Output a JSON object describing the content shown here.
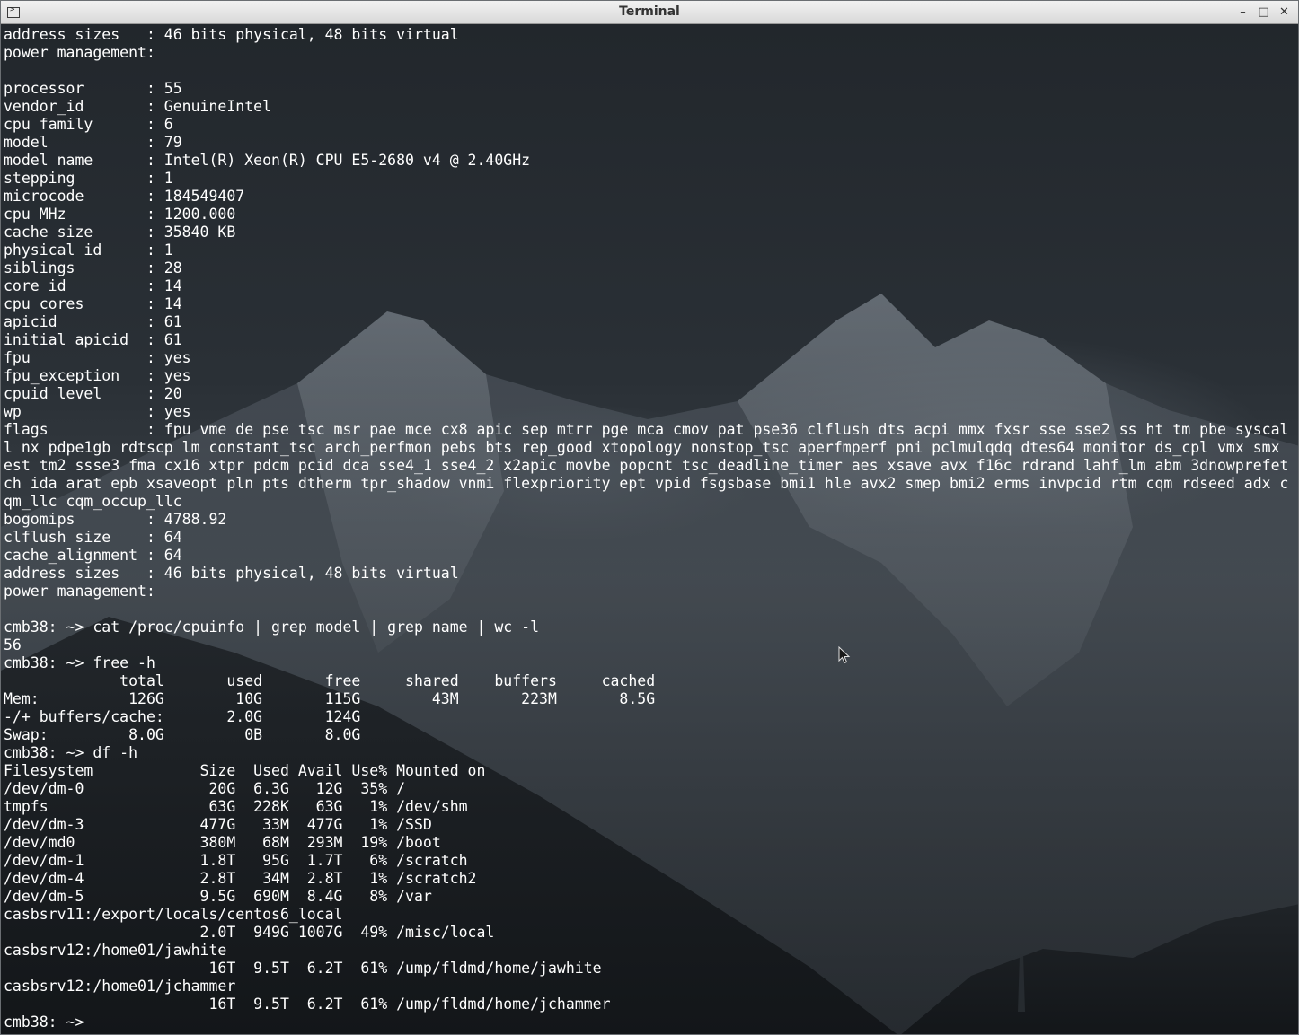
{
  "window": {
    "title": "Terminal",
    "minimize_glyph": "–",
    "maximize_glyph": "□",
    "close_glyph": "✕",
    "app_icon_glyph": ">_"
  },
  "terminal": {
    "lines": [
      "address sizes   : 46 bits physical, 48 bits virtual",
      "power management:",
      "",
      "processor       : 55",
      "vendor_id       : GenuineIntel",
      "cpu family      : 6",
      "model           : 79",
      "model name      : Intel(R) Xeon(R) CPU E5-2680 v4 @ 2.40GHz",
      "stepping        : 1",
      "microcode       : 184549407",
      "cpu MHz         : 1200.000",
      "cache size      : 35840 KB",
      "physical id     : 1",
      "siblings        : 28",
      "core id         : 14",
      "cpu cores       : 14",
      "apicid          : 61",
      "initial apicid  : 61",
      "fpu             : yes",
      "fpu_exception   : yes",
      "cpuid level     : 20",
      "wp              : yes",
      "flags           : fpu vme de pse tsc msr pae mce cx8 apic sep mtrr pge mca cmov pat pse36 clflush dts acpi mmx fxsr sse sse2 ss ht tm pbe syscal",
      "l nx pdpe1gb rdtscp lm constant_tsc arch_perfmon pebs bts rep_good xtopology nonstop_tsc aperfmperf pni pclmulqdq dtes64 monitor ds_cpl vmx smx",
      "est tm2 ssse3 fma cx16 xtpr pdcm pcid dca sse4_1 sse4_2 x2apic movbe popcnt tsc_deadline_timer aes xsave avx f16c rdrand lahf_lm abm 3dnowprefet",
      "ch ida arat epb xsaveopt pln pts dtherm tpr_shadow vnmi flexpriority ept vpid fsgsbase bmi1 hle avx2 smep bmi2 erms invpcid rtm cqm rdseed adx c",
      "qm_llc cqm_occup_llc",
      "bogomips        : 4788.92",
      "clflush size    : 64",
      "cache_alignment : 64",
      "address sizes   : 46 bits physical, 48 bits virtual",
      "power management:",
      "",
      "cmb38: ~> cat /proc/cpuinfo | grep model | grep name | wc -l",
      "56",
      "cmb38: ~> free -h",
      "             total       used       free     shared    buffers     cached",
      "Mem:          126G        10G       115G        43M       223M       8.5G",
      "-/+ buffers/cache:       2.0G       124G",
      "Swap:         8.0G         0B       8.0G",
      "cmb38: ~> df -h",
      "Filesystem            Size  Used Avail Use% Mounted on",
      "/dev/dm-0              20G  6.3G   12G  35% /",
      "tmpfs                  63G  228K   63G   1% /dev/shm",
      "/dev/dm-3             477G   33M  477G   1% /SSD",
      "/dev/md0              380M   68M  293M  19% /boot",
      "/dev/dm-1             1.8T   95G  1.7T   6% /scratch",
      "/dev/dm-4             2.8T   34M  2.8T   1% /scratch2",
      "/dev/dm-5             9.5G  690M  8.4G   8% /var",
      "casbsrv11:/export/locals/centos6_local",
      "                      2.0T  949G 1007G  49% /misc/local",
      "casbsrv12:/home01/jawhite",
      "                       16T  9.5T  6.2T  61% /ump/fldmd/home/jawhite",
      "casbsrv12:/home01/jchammer",
      "                       16T  9.5T  6.2T  61% /ump/fldmd/home/jchammer",
      "cmb38: ~> "
    ]
  }
}
